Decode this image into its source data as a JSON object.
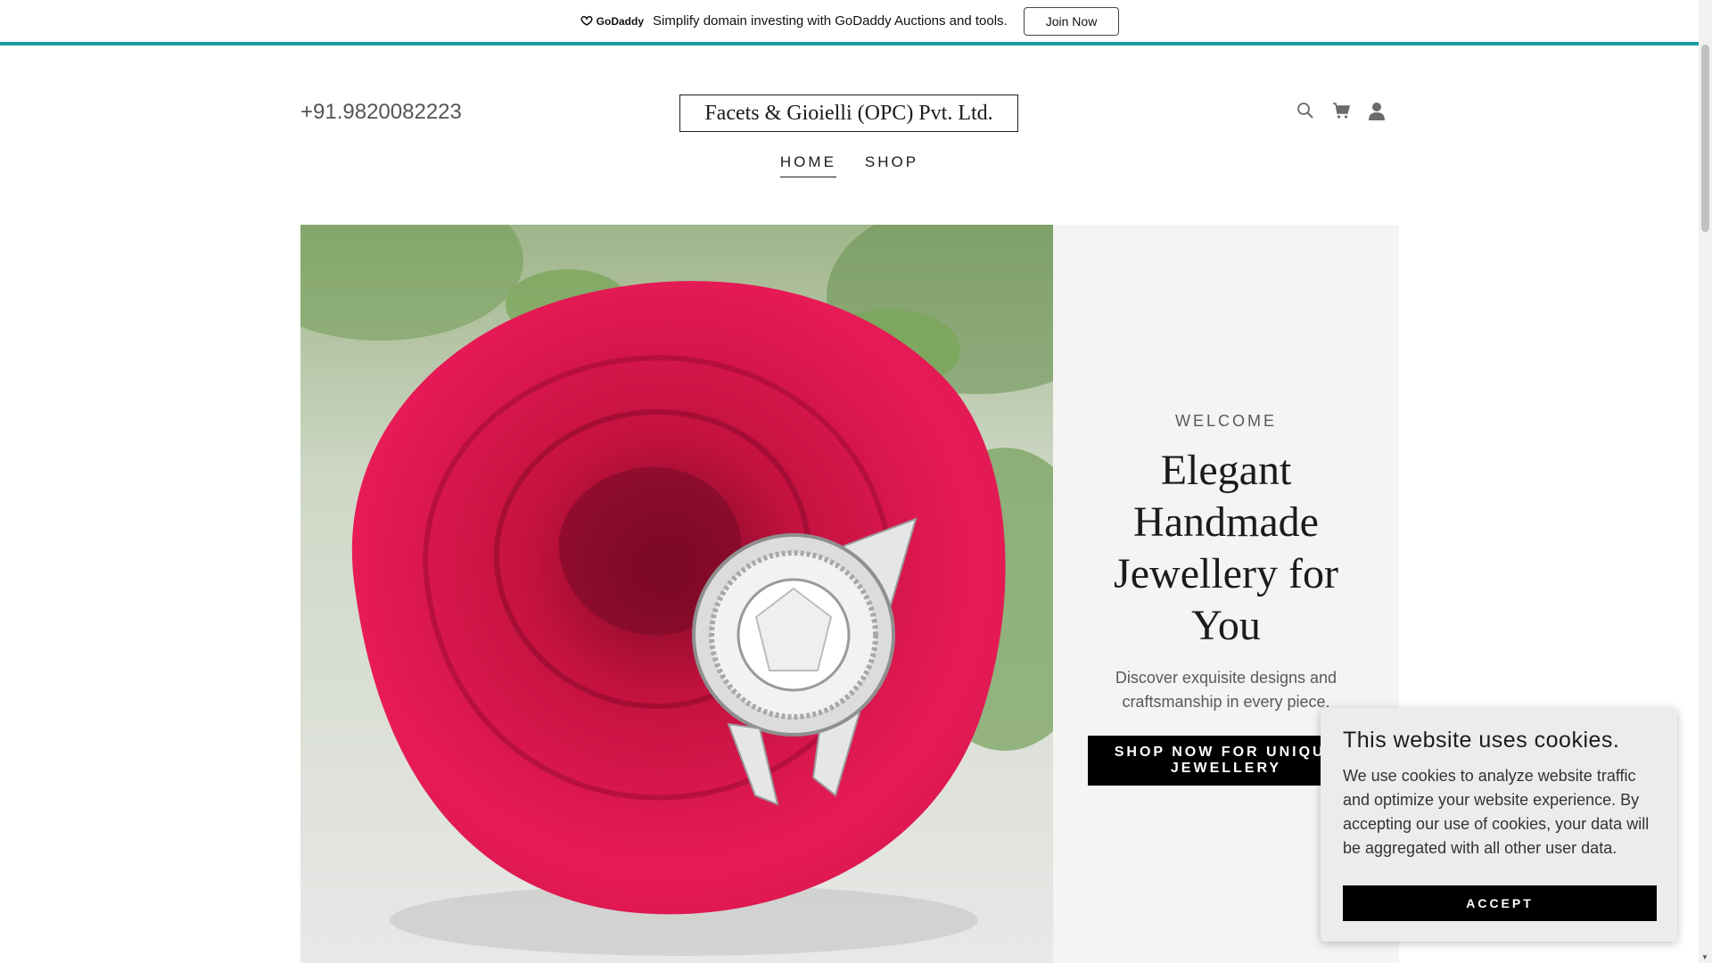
{
  "promo": {
    "brand": "GoDaddy",
    "message": "Simplify domain investing with GoDaddy Auctions and tools.",
    "button_label": "Join Now"
  },
  "header": {
    "phone": "+91.9820082223",
    "brand_name": "Facets & Gioielli (OPC) Pvt. Ltd.",
    "icons": [
      "search-icon",
      "cart-icon",
      "account-icon"
    ]
  },
  "nav": {
    "items": [
      {
        "label": "HOME",
        "active": true
      },
      {
        "label": "SHOP",
        "active": false
      }
    ]
  },
  "hero": {
    "eyebrow": "WELCOME",
    "headline": "Elegant Handmade Jewellery for You",
    "subtext": "Discover exquisite designs and craftsmanship in every piece.",
    "cta_label": "SHOP NOW FOR UNIQUE JEWELLERY"
  },
  "cookie": {
    "title": "This website uses cookies.",
    "body": "We use cookies to analyze website traffic and optimize your website experience. By accepting our use of cookies, your data will be aggregated with all other user data.",
    "accept_label": "ACCEPT"
  },
  "colors": {
    "accent_teal": "#1a9aa0",
    "rose": "#d9174e",
    "panel_bg": "#f4f4f2"
  }
}
